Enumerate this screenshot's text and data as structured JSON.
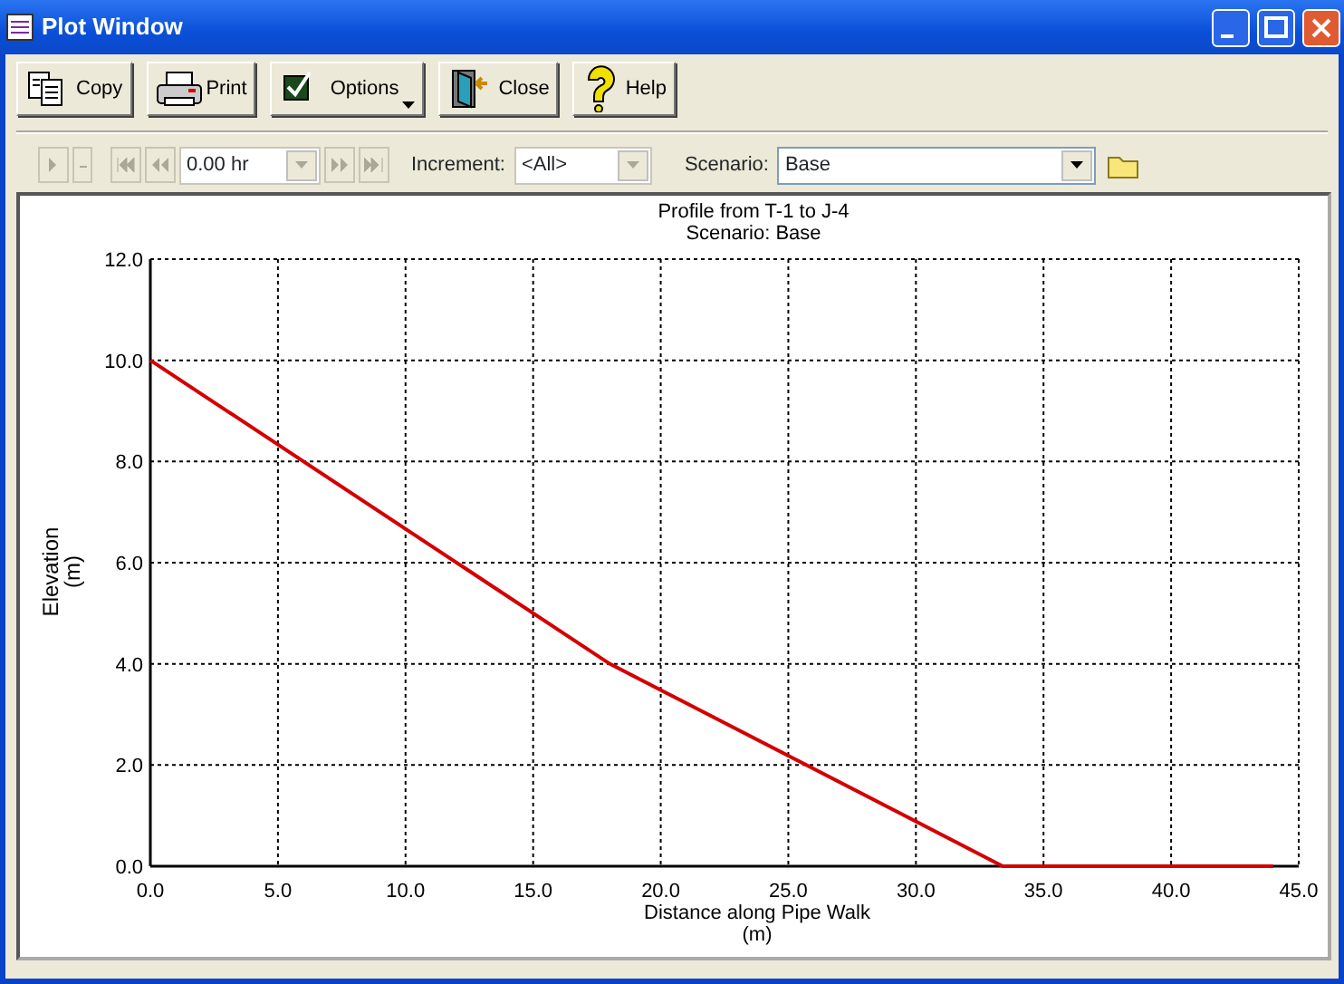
{
  "window": {
    "title": "Plot Window"
  },
  "toolbar": [
    {
      "kind": "copy",
      "label": "Copy"
    },
    {
      "kind": "print",
      "label": "Print"
    },
    {
      "kind": "options",
      "label": "Options",
      "has_menu": true
    },
    {
      "kind": "close",
      "label": "Close"
    },
    {
      "kind": "help",
      "label": "Help"
    }
  ],
  "playback": {
    "disabled": true,
    "time": {
      "value": "0.00 hr",
      "disabled": true
    }
  },
  "increment": {
    "label": "Increment:",
    "value": "<All>",
    "disabled": true
  },
  "scenario": {
    "label": "Scenario:",
    "value": "Base",
    "disabled": false
  },
  "chart": {
    "chart_data": {
      "type": "line",
      "title": "Profile from T-1 to J-4",
      "subtitle": "Scenario: Base",
      "xlabel": "Distance along Pipe Walk\n(m)",
      "ylabel": "Elevation\n(m)",
      "x": [
        0,
        18,
        33.4,
        44
      ],
      "series": [
        {
          "color": "#d40000",
          "values": [
            10,
            4,
            0,
            0
          ]
        }
      ],
      "grid": true,
      "xlim": [
        0,
        45
      ],
      "ylim": [
        0,
        12
      ],
      "xticks": [
        {
          "value": 0,
          "label": "0.0"
        },
        {
          "value": 5,
          "label": "5.0"
        },
        {
          "value": 10,
          "label": "10.0"
        },
        {
          "value": 15,
          "label": "15.0"
        },
        {
          "value": 20,
          "label": "20.0"
        },
        {
          "value": 25,
          "label": "25.0"
        },
        {
          "value": 30,
          "label": "30.0"
        },
        {
          "value": 35,
          "label": "35.0"
        },
        {
          "value": 40,
          "label": "40.0"
        },
        {
          "value": 45,
          "label": "45.0"
        }
      ],
      "yticks": [
        {
          "value": 0,
          "label": "0.0"
        },
        {
          "value": 2,
          "label": "2.0"
        },
        {
          "value": 4,
          "label": "4.0"
        },
        {
          "value": 6,
          "label": "6.0"
        },
        {
          "value": 8,
          "label": "8.0"
        },
        {
          "value": 10,
          "label": "10.0"
        },
        {
          "value": 12,
          "label": "12.0"
        }
      ]
    }
  }
}
